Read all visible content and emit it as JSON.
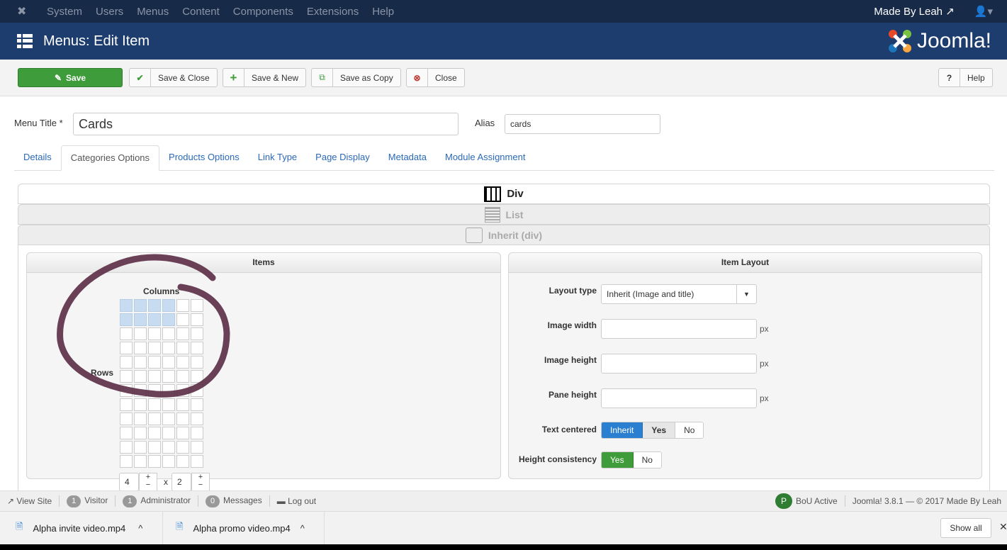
{
  "topmenu": {
    "items": [
      "System",
      "Users",
      "Menus",
      "Content",
      "Components",
      "Extensions",
      "Help"
    ],
    "user_site": "Made By Leah"
  },
  "header": {
    "title": "Menus: Edit Item",
    "logo": "Joomla!"
  },
  "toolbar": {
    "save": "Save",
    "save_close": "Save & Close",
    "save_new": "Save & New",
    "save_copy": "Save as Copy",
    "close": "Close",
    "help": "Help"
  },
  "form": {
    "title_label": "Menu Title *",
    "title_value": "Cards",
    "alias_label": "Alias",
    "alias_value": "cards"
  },
  "tabs": [
    "Details",
    "Categories Options",
    "Products Options",
    "Link Type",
    "Page Display",
    "Metadata",
    "Module Assignment"
  ],
  "accordion": [
    "Div",
    "List",
    "Inherit (div)"
  ],
  "items_panel": {
    "title": "Items",
    "columns_label": "Columns",
    "rows_label": "Rows",
    "columns_value": "4",
    "rows_value": "2",
    "times": "x",
    "plus": "+",
    "minus": "−",
    "grid_columns": 6,
    "grid_rows": 12
  },
  "layout_panel": {
    "title": "Item Layout",
    "layout_type_label": "Layout type",
    "layout_type_value": "Inherit (Image and title)",
    "image_width_label": "Image width",
    "image_height_label": "Image height",
    "pane_height_label": "Pane height",
    "unit": "px",
    "text_centered_label": "Text centered",
    "text_centered_options": [
      "Inherit",
      "Yes",
      "No"
    ],
    "height_consistency_label": "Height consistency",
    "height_consistency_options": [
      "Yes",
      "No"
    ]
  },
  "status": {
    "view_site": "View Site",
    "visitors": "1",
    "visitor_label": "Visitor",
    "admins": "1",
    "admin_label": "Administrator",
    "messages": "0",
    "messages_label": "Messages",
    "logout": "Log out",
    "bou": "BoU Active",
    "version": "Joomla! 3.8.1 — © 2017 Made By Leah"
  },
  "downloads": {
    "files": [
      "Alpha invite video.mp4",
      "Alpha promo video.mp4"
    ],
    "show_all": "Show all"
  },
  "colors": {
    "topbar": "#172a48",
    "header": "#1c3d6e",
    "save": "#3f9c3a",
    "active_blue": "#2b7fd0",
    "annotation": "#5a2c45"
  }
}
